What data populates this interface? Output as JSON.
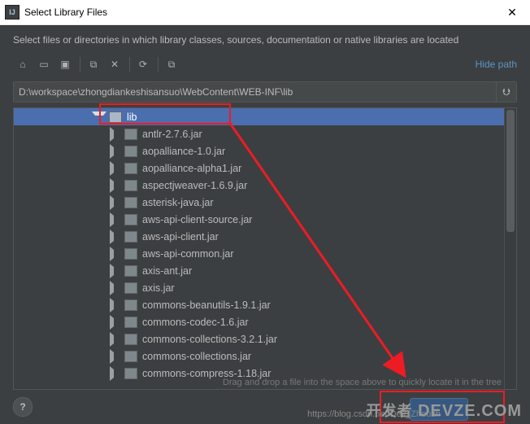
{
  "window": {
    "title": "Select Library Files",
    "close_glyph": "✕",
    "app_glyph": "IJ"
  },
  "info_text": "Select files or directories in which library classes, sources, documentation or native libraries are located",
  "toolbar": {
    "home": "⌂",
    "desktop": "▭",
    "project": "▣",
    "module": "▤",
    "new_folder": "⧉",
    "delete": "✕",
    "refresh": "⟳",
    "show_hidden": "⧉",
    "hide_path": "Hide path"
  },
  "path": {
    "value": "D:\\workspace\\zhongdiankeshisansuo\\WebContent\\WEB-INF\\lib",
    "history_glyph": "⮋"
  },
  "tree": {
    "root": {
      "label": "lib",
      "expanded": true
    },
    "items": [
      "antlr-2.7.6.jar",
      "aopalliance-1.0.jar",
      "aopalliance-alpha1.jar",
      "aspectjweaver-1.6.9.jar",
      "asterisk-java.jar",
      "aws-api-client-source.jar",
      "aws-api-client.jar",
      "aws-api-common.jar",
      "axis-ant.jar",
      "axis.jar",
      "commons-beanutils-1.9.1.jar",
      "commons-codec-1.6.jar",
      "commons-collections-3.2.1.jar",
      "commons-collections.jar",
      "commons-compress-1.18.jar"
    ],
    "hint": "Drag and drop a file into the space above to quickly locate it in the tree"
  },
  "footer": {
    "help": "?",
    "blog_url": "https://blog.csdn.net/Dev_Zhouzh"
  },
  "watermark": {
    "text": "开发者",
    "brand": "DEVZE.COM"
  }
}
